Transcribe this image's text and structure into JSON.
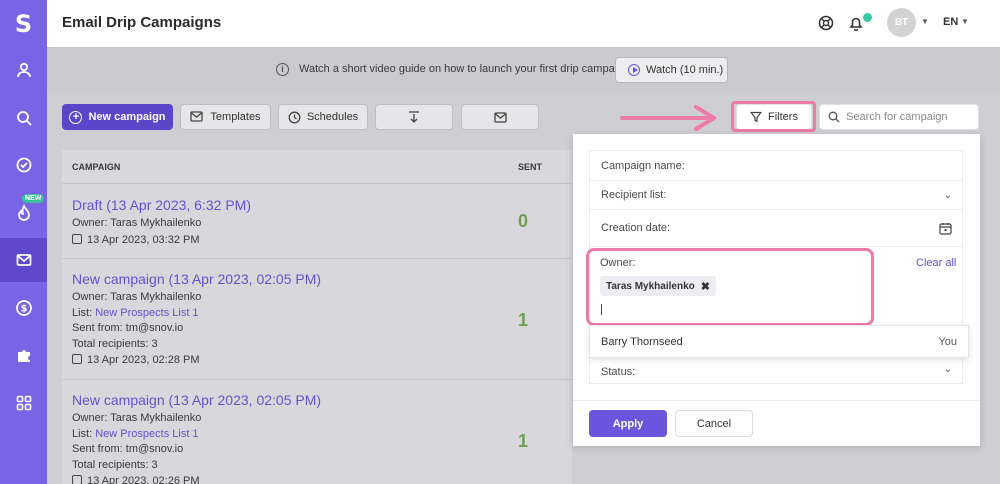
{
  "app": {
    "logo": "S"
  },
  "sidebar": {
    "items": [
      {
        "icon": "user-icon"
      },
      {
        "icon": "search-icon"
      },
      {
        "icon": "check-circle-icon"
      },
      {
        "icon": "flame-icon",
        "badge": "NEW"
      },
      {
        "icon": "mail-icon",
        "active": true
      },
      {
        "icon": "dollar-icon"
      },
      {
        "icon": "puzzle-icon"
      },
      {
        "icon": "grid-icon"
      }
    ]
  },
  "header": {
    "title": "Email Drip Campaigns",
    "avatar_initials": "BT",
    "language": "EN"
  },
  "banner": {
    "text": "Watch a short video guide on how to launch your first drip campaign",
    "watch_label": "Watch (10 min.)"
  },
  "toolbar": {
    "new_campaign": "New campaign",
    "templates": "Templates",
    "schedules": "Schedules",
    "filters": "Filters",
    "search_placeholder": "Search for campaign"
  },
  "table": {
    "columns": [
      "CAMPAIGN",
      "SENT"
    ],
    "rows": [
      {
        "title": "Draft (13 Apr 2023, 6:32 PM)",
        "owner": "Owner: Taras Mykhailenko",
        "date": "13 Apr 2023, 03:32 PM",
        "sent": "0"
      },
      {
        "title": "New campaign (13 Apr 2023, 02:05 PM)",
        "owner": "Owner: Taras Mykhailenko",
        "list_prefix": "List: ",
        "list": "New Prospects List 1",
        "sent_from": "Sent from: tm@snov.io",
        "total": "Total recipients: 3",
        "date": "13 Apr 2023, 02:28 PM",
        "sent": "1"
      },
      {
        "title": "New campaign (13 Apr 2023, 02:05 PM)",
        "owner": "Owner: Taras Mykhailenko",
        "list_prefix": "List: ",
        "list": "New Prospects List 1",
        "sent_from": "Sent from: tm@snov.io",
        "total": "Total recipients: 3",
        "date": "13 Apr 2023, 02:26 PM",
        "sent": "1"
      }
    ]
  },
  "filter_panel": {
    "campaign_name": "Campaign name:",
    "recipient_list": "Recipient list:",
    "creation_date": "Creation date:",
    "owner_label": "Owner:",
    "clear_all": "Clear all",
    "owner_tag": "Taras Mykhailenko",
    "dropdown_option": "Barry Thornseed",
    "dropdown_option_note": "You",
    "status": "Status:",
    "apply": "Apply",
    "cancel": "Cancel"
  },
  "colors": {
    "accent": "#6b55dc",
    "sidebar": "#7a64e6",
    "highlight": "#ee7aa8",
    "sent_green": "#6f9f52"
  }
}
